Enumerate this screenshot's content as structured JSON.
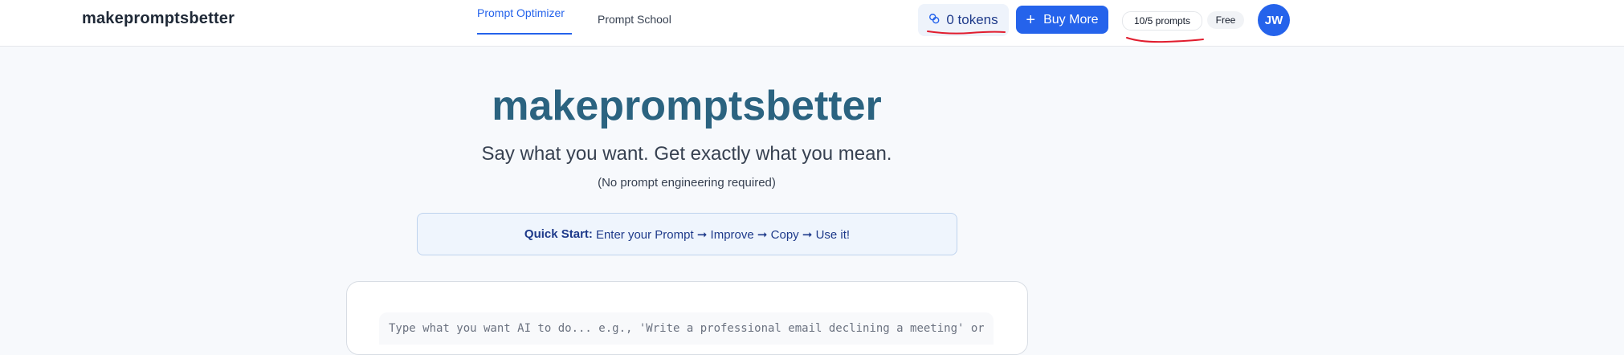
{
  "header": {
    "logo": "makepromptsbetter",
    "tabs": [
      {
        "label": "Prompt Optimizer",
        "active": true
      },
      {
        "label": "Prompt School",
        "active": false
      }
    ],
    "tokens_label": "0 tokens",
    "buy_label": "Buy More",
    "prompts_label": "10/5 prompts",
    "plan_label": "Free",
    "avatar_initials": "JW"
  },
  "hero": {
    "title": "makepromptsbetter",
    "subtitle": "Say what you want. Get exactly what you mean.",
    "note": "(No prompt engineering required)"
  },
  "quick_start": {
    "label": "Quick Start:",
    "text": "Enter your Prompt ➞ Improve ➞ Copy ➞ Use it!"
  },
  "editor": {
    "placeholder": "Type what you want AI to do... e.g., 'Write a professional email declining a meeting' or"
  },
  "colors": {
    "accent": "#2563eb",
    "title": "#2b6380",
    "annotation": "#e11d2e"
  }
}
